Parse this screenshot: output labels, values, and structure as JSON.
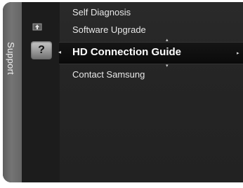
{
  "sidebar": {
    "label": "Support"
  },
  "icons": {
    "software_upgrade": "upgrade-icon",
    "hd_connection_guide": "question-mark-icon",
    "selected_glyph": "?"
  },
  "menu": {
    "items": [
      {
        "label": "Self Diagnosis"
      },
      {
        "label": "Software Upgrade"
      },
      {
        "label": "HD Connection Guide",
        "selected": true
      },
      {
        "label": "Contact Samsung"
      }
    ]
  },
  "glyphs": {
    "left_arrow": "◂",
    "right_arrow": "▸",
    "up": "▴",
    "down": "▾"
  },
  "colors": {
    "panel": "#181818",
    "strip": "#6e6e6e",
    "text": "#e8e8e8"
  }
}
